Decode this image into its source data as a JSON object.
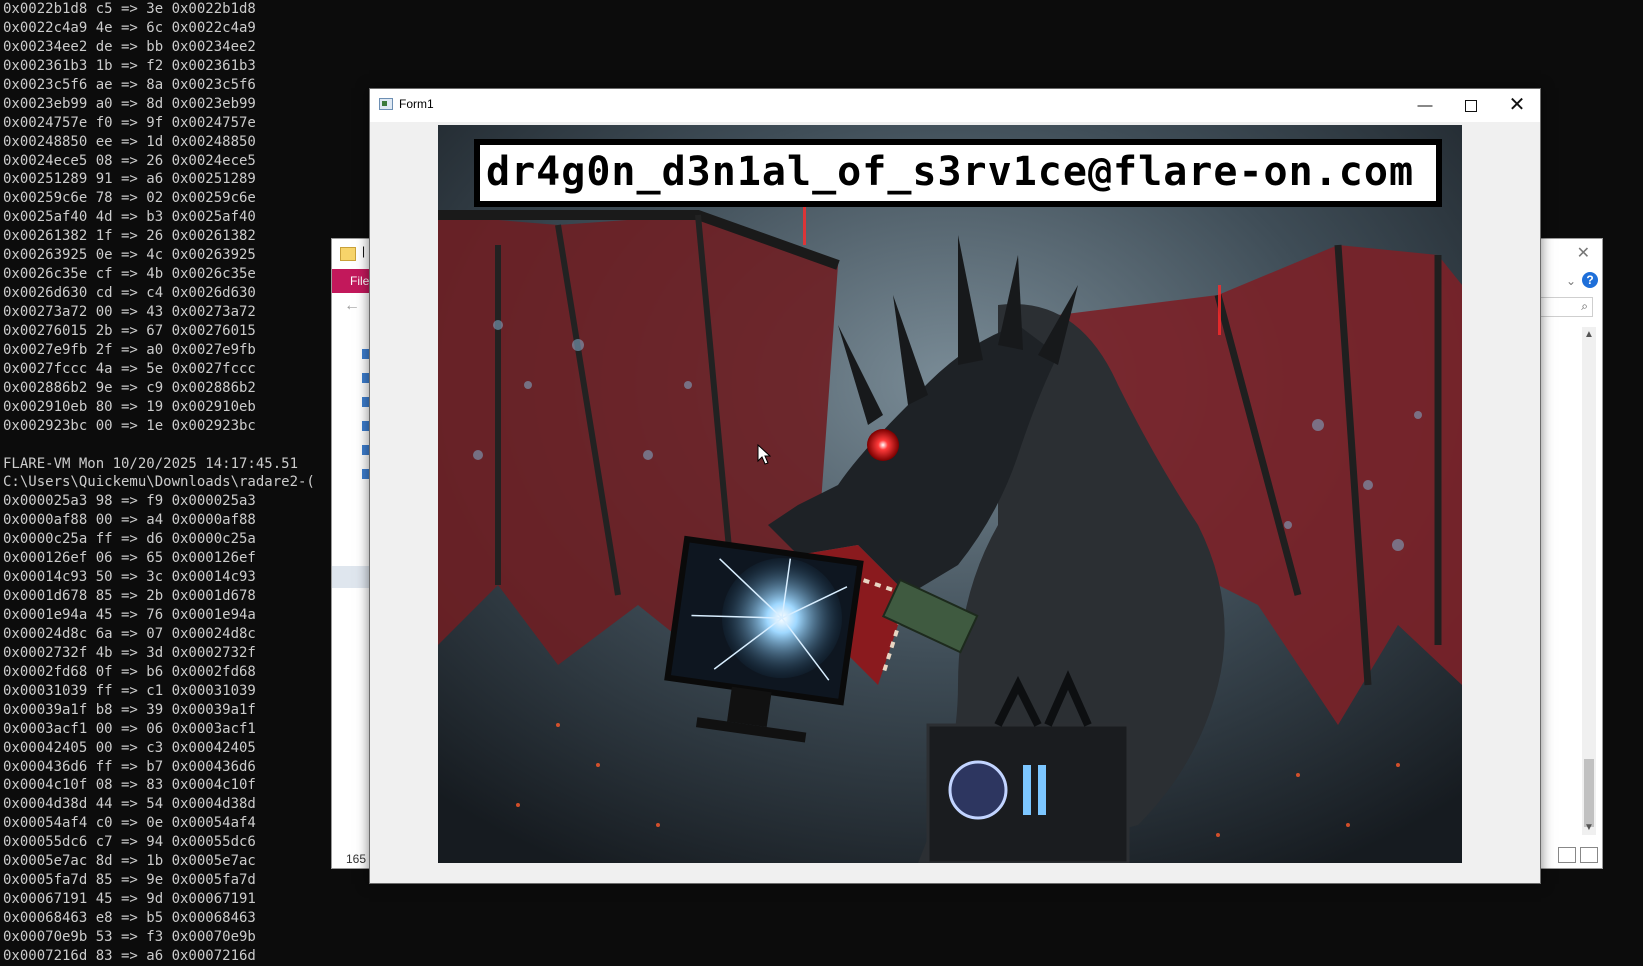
{
  "console": {
    "lines_top": [
      "0x0022b1d8 c5 => 3e 0x0022b1d8",
      "0x0022c4a9 4e => 6c 0x0022c4a9",
      "0x00234ee2 de => bb 0x00234ee2",
      "0x002361b3 1b => f2 0x002361b3",
      "0x0023c5f6 ae => 8a 0x0023c5f6",
      "0x0023eb99 a0 => 8d 0x0023eb99",
      "0x0024757e f0 => 9f 0x0024757e",
      "0x00248850 ee => 1d 0x00248850",
      "0x0024ece5 08 => 26 0x0024ece5",
      "0x00251289 91 => a6 0x00251289",
      "0x00259c6e 78 => 02 0x00259c6e",
      "0x0025af40 4d => b3 0x0025af40",
      "0x00261382 1f => 26 0x00261382",
      "0x00263925 0e => 4c 0x00263925",
      "0x0026c35e cf => 4b 0x0026c35e",
      "0x0026d630 cd => c4 0x0026d630",
      "0x00273a72 00 => 43 0x00273a72",
      "0x00276015 2b => 67 0x00276015",
      "0x0027e9fb 2f => a0 0x0027e9fb",
      "0x0027fccc 4a => 5e 0x0027fccc",
      "0x002886b2 9e => c9 0x002886b2",
      "0x002910eb 80 => 19 0x002910eb",
      "0x002923bc 00 => 1e 0x002923bc",
      "",
      "FLARE-VM Mon 10/20/2025 14:17:45.51",
      "C:\\Users\\Quickemu\\Downloads\\radare2-(",
      "0x000025a3 98 => f9 0x000025a3",
      "0x0000af88 00 => a4 0x0000af88",
      "0x0000c25a ff => d6 0x0000c25a",
      "0x000126ef 06 => 65 0x000126ef",
      "0x00014c93 50 => 3c 0x00014c93",
      "0x0001d678 85 => 2b 0x0001d678",
      "0x0001e94a 45 => 76 0x0001e94a",
      "0x00024d8c 6a => 07 0x00024d8c",
      "0x0002732f 4b => 3d 0x0002732f",
      "0x0002fd68 0f => b6 0x0002fd68",
      "0x00031039 ff => c1 0x00031039",
      "0x00039a1f b8 => 39 0x00039a1f",
      "0x0003acf1 00 => 06 0x0003acf1",
      "0x00042405 00 => c3 0x00042405",
      "0x000436d6 ff => b7 0x000436d6",
      "0x0004c10f 08 => 83 0x0004c10f",
      "0x0004d38d 44 => 54 0x0004d38d",
      "0x00054af4 c0 => 0e 0x00054af4",
      "0x00055dc6 c7 => 94 0x00055dc6",
      "0x0005e7ac 8d => 1b 0x0005e7ac",
      "0x0005fa7d 85 => 9e 0x0005fa7d",
      "0x00067191 45 => 9d 0x00067191",
      "0x00068463 e8 => b5 0x00068463",
      "0x00070e9b 53 => f3 0x00070e9b",
      "0x0007216d 83 => a6 0x0007216d"
    ]
  },
  "explorer": {
    "title": "|",
    "ribbon_file": "File",
    "status": "165 i"
  },
  "form": {
    "title": "Form1",
    "minimize": "—",
    "close": "✕",
    "picture": {
      "email": "dr4g0n_d3n1al_of_s3rv1ce@flare-on.com"
    }
  },
  "colors": {
    "console_bg": "#0c0c0c",
    "console_fg": "#cccccc",
    "accent_ribbon": "#c2185b",
    "dragon_red": "#b3262e"
  }
}
